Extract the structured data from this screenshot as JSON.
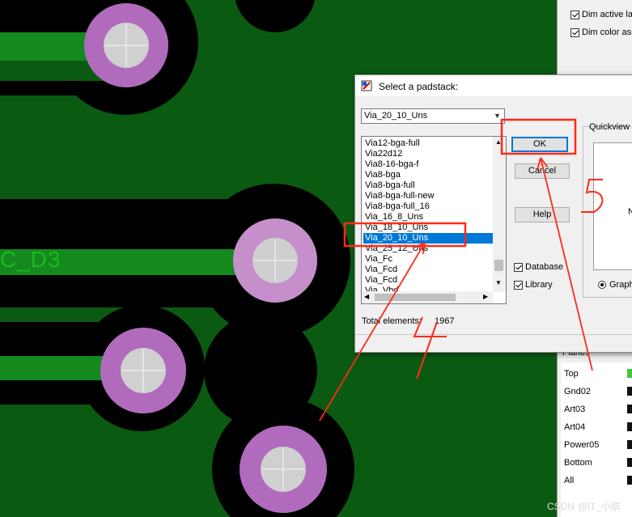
{
  "net_label": "C_D3",
  "right_panel": {
    "dim_active_label": "Dim active la",
    "dim_color_label": "Dim color ass",
    "planes_label": "Planes",
    "layers": [
      {
        "name": "Top",
        "swatch": "#3cc83c"
      },
      {
        "name": "Gnd02",
        "swatch": "#111111"
      },
      {
        "name": "Art03",
        "swatch": "#111111"
      },
      {
        "name": "Art04",
        "swatch": "#111111"
      },
      {
        "name": "Power05",
        "swatch": "#111111"
      },
      {
        "name": "Bottom",
        "swatch": "#111111"
      },
      {
        "name": "All",
        "swatch": "#111111"
      }
    ]
  },
  "dialog": {
    "title": "Select a padstack:",
    "combo_value": "Via_20_10_Uns",
    "list_items": [
      "Via12-bga-full",
      "Via22d12",
      "Via8-16-bga-f",
      "Via8-bga",
      "Via8-bga-full",
      "Via8-bga-full-new",
      "Via8-bga-full_16",
      "Via_16_8_Uns",
      "Via_18_10_Uns",
      "Via_20_10_Uns",
      "Via_25_12_Uns",
      "Via_Fc",
      "Via_Fcd",
      "Via_Fcd",
      "Via_Vbd"
    ],
    "selected_index": 9,
    "ok_label": "OK",
    "cancel_label": "Cancel",
    "help_label": "Help",
    "database_label": "Database",
    "library_label": "Library",
    "quickview_label": "Quickview",
    "quickview_text": "N",
    "graph_label": "Graph",
    "total_label": "Total elements:",
    "total_value": "1967"
  },
  "annotations": {
    "step4": "4",
    "step5": "5",
    "color": "#ff2a1a"
  },
  "watermark": "CSDN @IT_小航"
}
